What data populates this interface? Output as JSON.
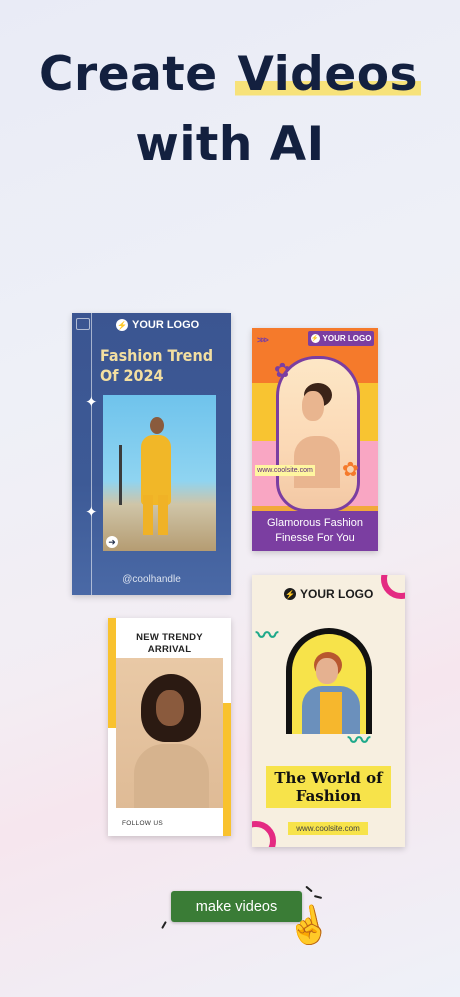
{
  "headline": {
    "line1_prefix": "Create ",
    "line1_highlight": "Videos",
    "line2": "with AI"
  },
  "cards": {
    "fashion_trend": {
      "logo": "YOUR LOGO",
      "title_line1": "Fashion Trend",
      "title_line2": "Of  2024",
      "handle": "@coolhandle"
    },
    "glamorous": {
      "logo": "YOUR LOGO",
      "site": "www.coolsite.com",
      "caption_line1": "Glamorous Fashion",
      "caption_line2": "Finesse For You"
    },
    "new_arrival": {
      "title_line1": "NEW TRENDY",
      "title_line2": "ARRIVAL",
      "follow": "FOLLOW US"
    },
    "world_of_fashion": {
      "logo": "YOUR LOGO",
      "title_line1": "The World of",
      "title_line2": "Fashion",
      "site": "www.coolsite.com"
    }
  },
  "cta": {
    "label": "make videos"
  },
  "icons": {
    "bolt": "⚡",
    "arrow": "➜",
    "sparkle": "✦",
    "flower": "✿",
    "cursor": "☝"
  },
  "colors": {
    "headline": "#13203f",
    "highlight": "#f7e27a",
    "cta": "#3a7c36",
    "purple": "#7b3ea1",
    "pink": "#e42a82",
    "yellow": "#f7e34a"
  }
}
